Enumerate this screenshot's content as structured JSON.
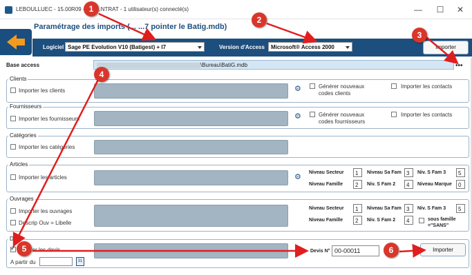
{
  "window": {
    "title": "LEBOULLUEC - 15.00R09 - S... ...NTRAT - 1 utilisateur(s) connecté(s)",
    "minimize": "—",
    "maximize": "☐",
    "close": "✕"
  },
  "page": {
    "title": "Paramétrage des imports (... ...7 pointer le Batig.mdb)"
  },
  "toolbar": {
    "logiciel_label": "Logiciel",
    "logiciel_value": "Sage PE Evolution V10 (Batigest) + I7",
    "version_label": "Version d'Access",
    "version_value": "Microsoft® Access 2000",
    "importer_label": "Importer"
  },
  "base_access": {
    "label": "Base access",
    "path": "\\Bureau\\BatiG.mdb",
    "browse": "•••"
  },
  "clients": {
    "title": "Clients",
    "import_label": "Importer les clients",
    "generate_label_1": "Générer nouveaux",
    "generate_label_2": "codes clients",
    "contacts_label": "Importer les contacts"
  },
  "fournisseurs": {
    "title": "Fournisseurs",
    "import_label": "Importer les fournisseurs",
    "generate_label_1": "Générer nouveaux",
    "generate_label_2": "codes fournisseurs",
    "contacts_label": "Importer les contacts"
  },
  "categories": {
    "title": "Catégories",
    "import_label": "Importer les catégories"
  },
  "articles": {
    "title": "Articles",
    "import_label": "Importer les articles",
    "niveau_secteur_label": "Niveau Secteur",
    "niveau_secteur": "1",
    "niv_sa_fam_label": "Niveau Sa Fam",
    "niv_sa_fam": "3",
    "niv_s_fam3_label": "Niv. S Fam 3",
    "niv_s_fam3": "5",
    "niveau_famille_label": "Niveau Famille",
    "niveau_famille": "2",
    "niv_s_fam2_label": "Niv. S Fam 2",
    "niv_s_fam2": "4",
    "niveau_marque_label": "Niveau Marque",
    "niveau_marque": "0"
  },
  "ouvrages": {
    "title": "Ouvrages",
    "import_label": "Importer les ouvrages",
    "descrip_label": "Descrip Ouv = Libelle",
    "niveau_secteur_label": "Niveau Secteur",
    "niveau_secteur": "1",
    "niv_sa_fam_label": "Niveau Sa Fam",
    "niv_sa_fam": "3",
    "niv_s_fam3_label": "Niv. S Fam 3",
    "niv_s_fam3": "5",
    "niveau_famille_label": "Niveau Famille",
    "niveau_famille": "2",
    "niv_s_fam2_label": "Niv. S Fam 2",
    "niv_s_fam2": "4",
    "sous_famille_label_1": "sous",
    "sous_famille_label_2": "famille",
    "sous_famille_label_3": "=\"SANS\""
  },
  "devis": {
    "title": "De...",
    "import_label": "...er les devis",
    "a_partir_label": "A partir du",
    "devis_no_label": "Devis N°",
    "devis_no_value": "00-00011",
    "importer_label": "Importer"
  },
  "markers": [
    "1",
    "2",
    "3",
    "4",
    "5",
    "6"
  ],
  "colors": {
    "toolbar_bg": "#1d4f7e",
    "back_arrow": "#f39a1e",
    "marker": "#d9362b",
    "arrow": "#e01e1e"
  }
}
